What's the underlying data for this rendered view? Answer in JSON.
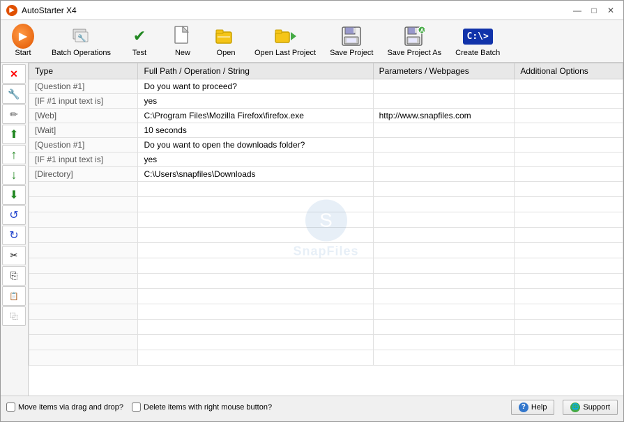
{
  "titleBar": {
    "title": "AutoStarter X4",
    "controls": {
      "minimize": "—",
      "maximize": "□",
      "close": "✕"
    }
  },
  "toolbar": {
    "buttons": [
      {
        "id": "start",
        "label": "Start",
        "icon": "start"
      },
      {
        "id": "batch-operations",
        "label": "Batch Operations",
        "icon": "batch-ops"
      },
      {
        "id": "test",
        "label": "Test",
        "icon": "test"
      },
      {
        "id": "new",
        "label": "New",
        "icon": "new"
      },
      {
        "id": "open",
        "label": "Open",
        "icon": "open"
      },
      {
        "id": "open-last",
        "label": "Open Last Project",
        "icon": "open-last"
      },
      {
        "id": "save",
        "label": "Save Project",
        "icon": "save"
      },
      {
        "id": "save-as",
        "label": "Save Project As",
        "icon": "save-as"
      },
      {
        "id": "create-batch",
        "label": "Create Batch",
        "icon": "batch"
      }
    ]
  },
  "sideToolbar": {
    "buttons": [
      {
        "id": "delete",
        "label": "Delete",
        "icon": "✕",
        "style": "delete"
      },
      {
        "id": "edit",
        "label": "Edit",
        "icon": "✎",
        "style": "normal"
      },
      {
        "id": "pencil",
        "label": "Properties",
        "icon": "✏",
        "style": "normal"
      },
      {
        "id": "move-up-fast",
        "label": "Move Up Fast",
        "icon": "⬆",
        "style": "normal"
      },
      {
        "id": "move-up",
        "label": "Move Up",
        "icon": "↑",
        "style": "normal"
      },
      {
        "id": "move-down",
        "label": "Move Down",
        "icon": "↓",
        "style": "normal"
      },
      {
        "id": "move-down-fast",
        "label": "Move Down Fast",
        "icon": "⬇",
        "style": "normal"
      },
      {
        "id": "rotate-up",
        "label": "Rotate Up",
        "icon": "↺",
        "style": "normal"
      },
      {
        "id": "rotate-down",
        "label": "Rotate Down",
        "icon": "↻",
        "style": "normal"
      },
      {
        "id": "cut",
        "label": "Cut",
        "icon": "✂",
        "style": "normal"
      },
      {
        "id": "copy",
        "label": "Copy",
        "icon": "⎘",
        "style": "normal"
      },
      {
        "id": "paste",
        "label": "Paste",
        "icon": "📋",
        "style": "normal"
      },
      {
        "id": "duplicate",
        "label": "Duplicate",
        "icon": "⿻",
        "style": "normal"
      }
    ]
  },
  "table": {
    "columns": [
      {
        "id": "type",
        "label": "Type"
      },
      {
        "id": "fullpath",
        "label": "Full Path / Operation / String"
      },
      {
        "id": "params",
        "label": "Parameters / Webpages"
      },
      {
        "id": "options",
        "label": "Additional Options"
      }
    ],
    "rows": [
      {
        "type": "[Question #1]",
        "fullpath": "Do you want to proceed?",
        "params": "",
        "options": ""
      },
      {
        "type": "[IF #1 input text is]",
        "fullpath": "yes",
        "params": "",
        "options": ""
      },
      {
        "type": "[Web]",
        "fullpath": "C:\\Program Files\\Mozilla Firefox\\firefox.exe",
        "params": "http://www.snapfiles.com",
        "options": ""
      },
      {
        "type": "[Wait]",
        "fullpath": "10 seconds",
        "params": "",
        "options": ""
      },
      {
        "type": "[Question #1]",
        "fullpath": "Do you want to open the downloads folder?",
        "params": "",
        "options": ""
      },
      {
        "type": "[IF #1 input text is]",
        "fullpath": "yes",
        "params": "",
        "options": ""
      },
      {
        "type": "[Directory]",
        "fullpath": "C:\\Users\\snapfiles\\Downloads",
        "params": "",
        "options": ""
      }
    ]
  },
  "watermark": {
    "text": "SnapFiles"
  },
  "statusBar": {
    "checkbox1": {
      "label": "Move items via drag and drop?",
      "checked": false
    },
    "checkbox2": {
      "label": "Delete items with right mouse button?",
      "checked": false
    },
    "helpBtn": "Help",
    "supportBtn": "Support"
  }
}
